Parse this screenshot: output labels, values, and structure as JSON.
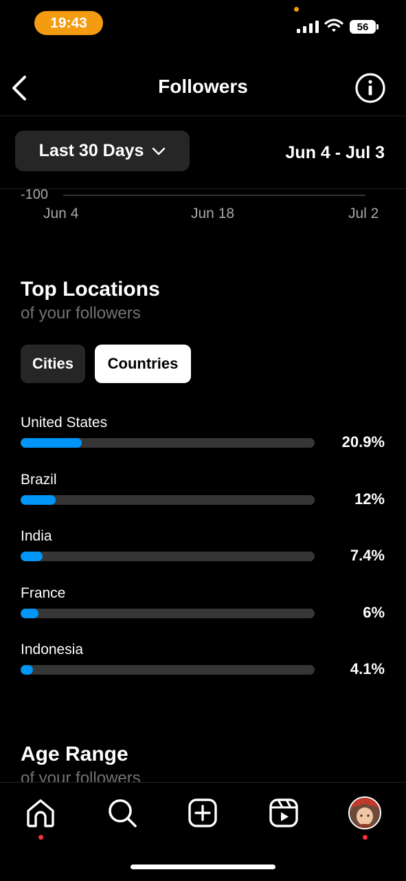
{
  "status": {
    "time": "19:43",
    "battery": "56"
  },
  "header": {
    "title": "Followers"
  },
  "period": {
    "label": "Last 30 Days",
    "range": "Jun 4 - Jul 3"
  },
  "chart_data": {
    "type": "line",
    "y_ticks": [
      "-100"
    ],
    "x_ticks": [
      "Jun 4",
      "Jun 18",
      "Jul 2"
    ]
  },
  "locations": {
    "title": "Top Locations",
    "subtitle": "of your followers",
    "tabs": {
      "cities": "Cities",
      "countries": "Countries",
      "selected": "Countries"
    },
    "items": [
      {
        "name": "United States",
        "percent_label": "20.9%",
        "value": 20.9
      },
      {
        "name": "Brazil",
        "percent_label": "12%",
        "value": 12
      },
      {
        "name": "India",
        "percent_label": "7.4%",
        "value": 7.4
      },
      {
        "name": "France",
        "percent_label": "6%",
        "value": 6
      },
      {
        "name": "Indonesia",
        "percent_label": "4.1%",
        "value": 4.1
      }
    ]
  },
  "age": {
    "title": "Age Range",
    "subtitle": "of your followers"
  },
  "colors": {
    "accent": "#0095f6",
    "notification": "#ff3040",
    "time_pill": "#f39c12"
  }
}
